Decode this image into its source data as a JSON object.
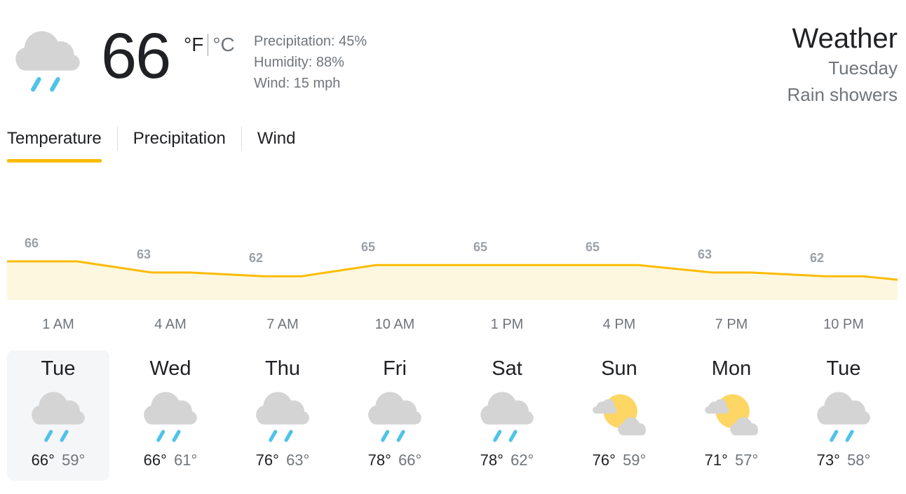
{
  "current": {
    "temperature": "66",
    "unit_f": "°F",
    "unit_c": "°C",
    "icon": "rain-showers-icon",
    "precipitation": "Precipitation: 45%",
    "humidity": "Humidity: 88%",
    "wind": "Wind: 15 mph"
  },
  "header": {
    "title": "Weather",
    "day": "Tuesday",
    "condition": "Rain showers"
  },
  "tabs": [
    {
      "label": "Temperature",
      "active": true
    },
    {
      "label": "Precipitation",
      "active": false
    },
    {
      "label": "Wind",
      "active": false
    }
  ],
  "colors": {
    "accent": "#fbbc04",
    "chart_fill": "#fef7e0",
    "text_primary": "#202124",
    "text_secondary": "#70757a",
    "cloud": "#d4d4d4",
    "rain": "#4fc3e8",
    "sun": "#fdd663"
  },
  "chart_data": {
    "type": "area",
    "title": "",
    "xlabel": "",
    "ylabel": "",
    "x": [
      "1 AM",
      "4 AM",
      "7 AM",
      "10 AM",
      "1 PM",
      "4 PM",
      "7 PM",
      "10 PM"
    ],
    "values": [
      66,
      63,
      62,
      65,
      65,
      65,
      63,
      62
    ],
    "data_labels": [
      "66",
      "63",
      "62",
      "65",
      "65",
      "65",
      "63",
      "62"
    ],
    "series": [
      {
        "values": [
          66,
          63,
          62,
          65,
          65,
          65,
          63,
          62
        ]
      }
    ]
  },
  "daily": [
    {
      "day": "Tue",
      "high": "66°",
      "low": "59°",
      "icon": "rain-showers-icon",
      "selected": true
    },
    {
      "day": "Wed",
      "high": "66°",
      "low": "61°",
      "icon": "rain-showers-icon",
      "selected": false
    },
    {
      "day": "Thu",
      "high": "76°",
      "low": "63°",
      "icon": "rain-showers-icon",
      "selected": false
    },
    {
      "day": "Fri",
      "high": "78°",
      "low": "66°",
      "icon": "rain-showers-icon",
      "selected": false
    },
    {
      "day": "Sat",
      "high": "78°",
      "low": "62°",
      "icon": "rain-showers-icon",
      "selected": false
    },
    {
      "day": "Sun",
      "high": "76°",
      "low": "59°",
      "icon": "partly-cloudy-icon",
      "selected": false
    },
    {
      "day": "Mon",
      "high": "71°",
      "low": "57°",
      "icon": "partly-cloudy-icon",
      "selected": false
    },
    {
      "day": "Tue",
      "high": "73°",
      "low": "58°",
      "icon": "rain-showers-icon",
      "selected": false
    }
  ]
}
